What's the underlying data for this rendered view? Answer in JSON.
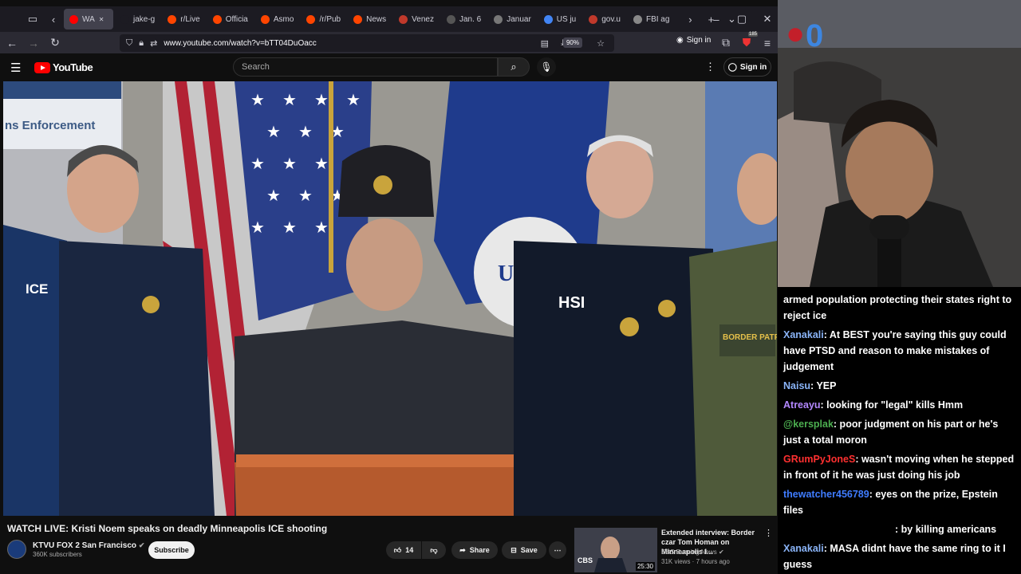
{
  "browser": {
    "tabs": [
      {
        "label": "WA",
        "color": "#ff0000",
        "active": true
      },
      {
        "label": "jake-g",
        "color": "#1c1b22"
      },
      {
        "label": "r/Live",
        "color": "#ff4500"
      },
      {
        "label": "Officia",
        "color": "#ff4500"
      },
      {
        "label": "Asmo",
        "color": "#ff4500"
      },
      {
        "label": "/r/Pub",
        "color": "#ff4500"
      },
      {
        "label": "News",
        "color": "#ff4500"
      },
      {
        "label": "Venez",
        "color": "#c0392b"
      },
      {
        "label": "Jan. 6",
        "color": "#555"
      },
      {
        "label": "Januar",
        "color": "#777"
      },
      {
        "label": "US ju",
        "color": "#4285f4"
      },
      {
        "label": "gov.u",
        "color": "#c0392b"
      },
      {
        "label": "FBI ag",
        "color": "#888"
      }
    ],
    "url": "www.youtube.com/watch?v=bTT04DuOacc",
    "zoom": "90%",
    "signin": "Sign in",
    "badge_count": "185"
  },
  "youtube": {
    "logo": "YouTube",
    "search_placeholder": "Search",
    "signin": "Sign in",
    "video_title": "WATCH LIVE: Kristi Noem speaks on deadly Minneapolis ICE shooting",
    "channel_name": "KTVU FOX 2 San Francisco",
    "subscribers": "360K subscribers",
    "subscribe": "Subscribe",
    "likes": "14",
    "share": "Share",
    "save": "Save",
    "video_sign": "ns Enforcement",
    "related": {
      "title": "Extended interview: Border czar Tom Homan on Minneapolis I...",
      "channel": "CBS Evening News",
      "meta": "31K views · 7 hours ago",
      "duration": "25:30"
    }
  },
  "chat": {
    "messages": [
      {
        "user": "",
        "text": "armed population protecting their states right to reject ice",
        "color": "#ffffff"
      },
      {
        "user": "Xanakali",
        "text": ": At BEST you're saying this guy could have PTSD and reason to make mistakes of judgement",
        "color": "#8ab4f8"
      },
      {
        "user": "Naisu",
        "text": ": YEP",
        "color": "#8ab4f8"
      },
      {
        "user": "Atreayu",
        "text": ": looking for \"legal\" kills Hmm",
        "color": "#b388ff"
      },
      {
        "user": "@kersplak",
        "text": ": poor judgment on his part or he's just a total moron",
        "color": "#4caf50"
      },
      {
        "user": "GRumPyJoneS",
        "text": ": wasn't moving when he stepped in front of it he was just doing his job",
        "color": "#ff3030"
      },
      {
        "user": "thewatcher456789",
        "text": ": eyes on the prize, Epstein files",
        "color": "#3f7cff"
      },
      {
        "user": "",
        "text": ": by killing americans",
        "color": "#ffffff"
      },
      {
        "user": "Xanakali",
        "text": ": MASA didnt have the same ring to it I guess",
        "color": "#8ab4f8"
      }
    ]
  }
}
